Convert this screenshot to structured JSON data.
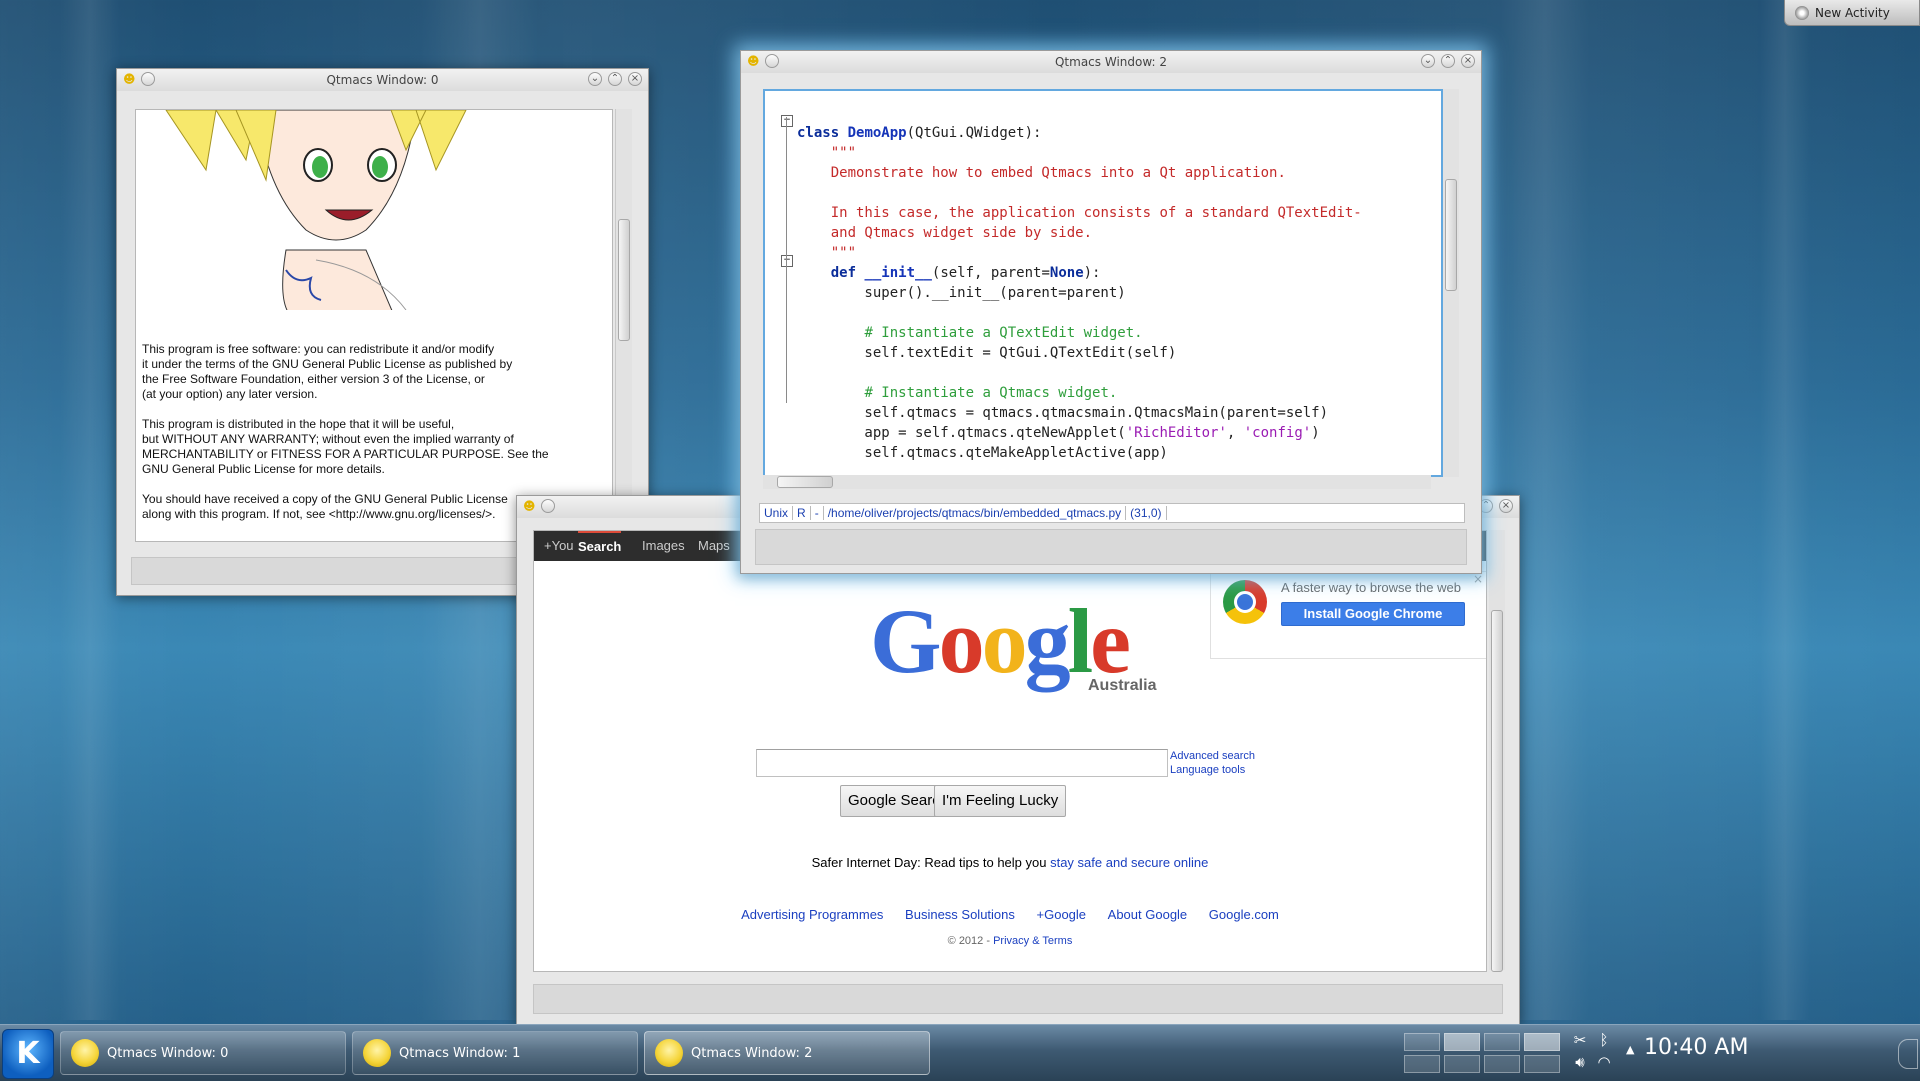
{
  "desktop": {
    "new_activity": "New Activity"
  },
  "window0": {
    "title": "Qtmacs Window: 0",
    "license_text": "This program is free software: you can redistribute it and/or modify\nit under the terms of the GNU General Public License as published by\nthe Free Software Foundation, either version 3 of the License, or\n(at your option) any later version.\n\nThis program is distributed in the hope that it will be useful,\nbut WITHOUT ANY WARRANTY; without even the implied warranty of\nMERCHANTABILITY or FITNESS FOR A PARTICULAR PURPOSE. See the\nGNU General Public License for more details.\n\nYou should have received a copy of the GNU General Public License\nalong with this program.  If not, see <http://www.gnu.org/licenses/>."
  },
  "window2": {
    "title": "Qtmacs Window: 2",
    "modeline": {
      "eol": "Unix",
      "mode": "R",
      "sep": "-",
      "path": "/home/oliver/projects/qtmacs/bin/embedded_qtmacs.py",
      "pos": "(31,0)"
    }
  },
  "browser": {
    "gbar": [
      "+You",
      "Search",
      "Images",
      "Maps"
    ],
    "logo": {
      "g1": "G",
      "o1": "o",
      "o2": "o",
      "g2": "g",
      "l": "l",
      "e": "e"
    },
    "logo_sub": "Australia",
    "promo": {
      "text": "A faster way to browse the web",
      "button": "Install Google Chrome",
      "close": "×"
    },
    "search_value": "",
    "advanced_search": "Advanced search",
    "language_tools": "Language tools",
    "btn_search": "Google Search",
    "btn_lucky": "I'm Feeling Lucky",
    "safer_prefix": "Safer Internet Day: Read tips to help you ",
    "safer_link": "stay safe and secure online",
    "footer_links": [
      "Advertising Programmes",
      "Business Solutions",
      "+Google",
      "About Google",
      "Google.com"
    ],
    "copyright": "© 2012 - ",
    "privacy_link": "Privacy & Terms"
  },
  "taskbar": {
    "tasks": [
      "Qtmacs Window: 0",
      "Qtmacs Window: 1",
      "Qtmacs Window: 2"
    ],
    "clock": "10:40 AM",
    "tray_icons": [
      "scissors-icon",
      "bluetooth-icon",
      "volume-icon",
      "wifi-icon"
    ]
  },
  "colors": {
    "accent_glow": "#87d2ff",
    "link": "#1a3fc0",
    "chrome_button": "#3c7ee8"
  }
}
